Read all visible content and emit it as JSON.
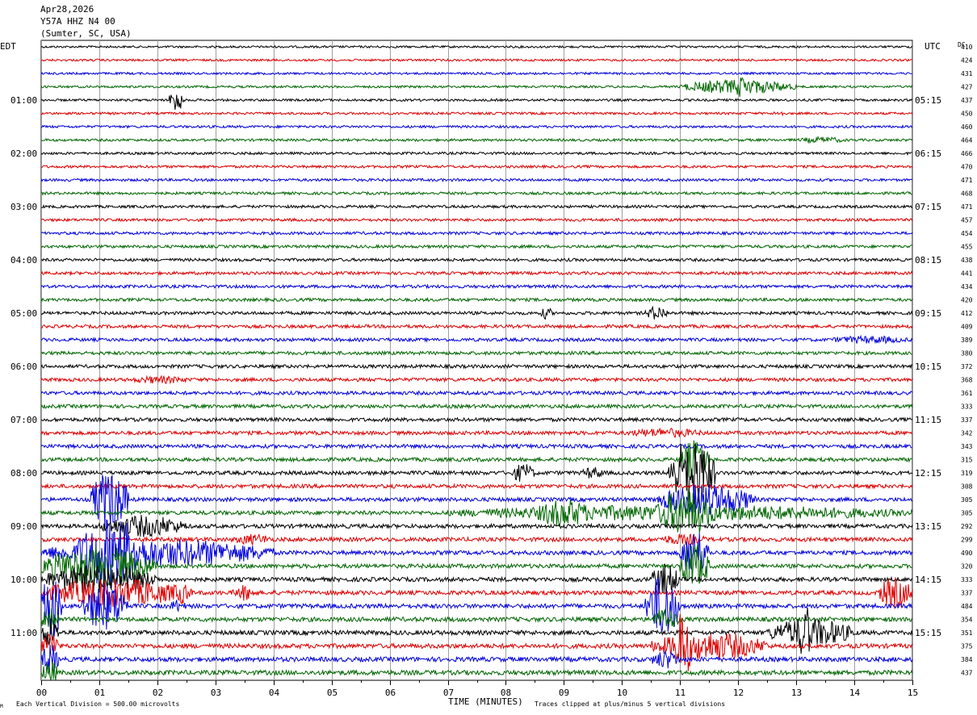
{
  "header": {
    "date": "Apr28,2026",
    "station": "Y57A HHZ N4 00",
    "location": "(Sumter, SC, USA)"
  },
  "chart_data": {
    "type": "line",
    "title": "",
    "left_axis_label": "EDT",
    "right_axis_label": "UTC",
    "dc_label": "DC",
    "xlabel": "TIME (MINUTES)",
    "xlim": [
      0,
      15
    ],
    "x_ticks": [
      "00",
      "01",
      "02",
      "03",
      "04",
      "05",
      "06",
      "07",
      "08",
      "09",
      "10",
      "11",
      "12",
      "13",
      "14",
      "15"
    ],
    "left_hour_labels": [
      "01:00",
      "02:00",
      "03:00",
      "04:00",
      "05:00",
      "06:00",
      "07:00",
      "08:00",
      "09:00",
      "10:00",
      "11:00"
    ],
    "right_hour_labels": [
      "05:15",
      "06:15",
      "07:15",
      "08:15",
      "09:15",
      "10:15",
      "11:15",
      "12:15",
      "13:15",
      "14:15",
      "15:15"
    ],
    "trace_colors": [
      "#000000",
      "#dd0000",
      "#0000dd",
      "#006600"
    ],
    "trace_count": 48,
    "dc_offsets": [
      410,
      424,
      431,
      427,
      437,
      450,
      460,
      464,
      466,
      470,
      471,
      468,
      471,
      457,
      454,
      455,
      438,
      441,
      434,
      420,
      412,
      409,
      389,
      380,
      372,
      368,
      361,
      333,
      337,
      342,
      343,
      315,
      319,
      308,
      305,
      305,
      292,
      299,
      490,
      320,
      333,
      337,
      484,
      354,
      351,
      375,
      384,
      437
    ],
    "scale_note": "Each Vertical Division =   500.00 microvolts",
    "clip_note": "Traces clipped at plus/minus 5 vertical divisions",
    "corner_mark": "M",
    "events": [
      {
        "trace": 4,
        "t0": 2.2,
        "t1": 2.45,
        "amp": 16
      },
      {
        "trace": 3,
        "t0": 11.0,
        "t1": 13.0,
        "amp": 9
      },
      {
        "trace": 3,
        "t0": 11.9,
        "t1": 12.3,
        "amp": 14
      },
      {
        "trace": 5,
        "t0": 12.6,
        "t1": 12.8,
        "amp": 4
      },
      {
        "trace": 7,
        "t0": 13.0,
        "t1": 13.9,
        "amp": 4
      },
      {
        "trace": 20,
        "t0": 8.6,
        "t1": 8.8,
        "amp": 8
      },
      {
        "trace": 20,
        "t0": 10.4,
        "t1": 10.8,
        "amp": 9
      },
      {
        "trace": 22,
        "t0": 13.5,
        "t1": 15.0,
        "amp": 5
      },
      {
        "trace": 25,
        "t0": 1.5,
        "t1": 2.6,
        "amp": 5
      },
      {
        "trace": 29,
        "t0": 10.0,
        "t1": 11.5,
        "amp": 6
      },
      {
        "trace": 32,
        "t0": 8.1,
        "t1": 8.5,
        "amp": 12
      },
      {
        "trace": 32,
        "t0": 9.3,
        "t1": 9.7,
        "amp": 8
      },
      {
        "trace": 32,
        "t0": 10.8,
        "t1": 11.6,
        "amp": 45
      },
      {
        "trace": 31,
        "t0": 11.0,
        "t1": 11.5,
        "amp": 25
      },
      {
        "trace": 34,
        "t0": 0.85,
        "t1": 1.5,
        "amp": 38
      },
      {
        "trace": 34,
        "t0": 10.6,
        "t1": 12.3,
        "amp": 20
      },
      {
        "trace": 35,
        "t0": 7.0,
        "t1": 15.0,
        "amp": 10
      },
      {
        "trace": 35,
        "t0": 8.5,
        "t1": 9.5,
        "amp": 18
      },
      {
        "trace": 35,
        "t0": 10.6,
        "t1": 11.6,
        "amp": 30
      },
      {
        "trace": 36,
        "t0": 1.0,
        "t1": 2.5,
        "amp": 14
      },
      {
        "trace": 37,
        "t0": 3.3,
        "t1": 4.0,
        "amp": 7
      },
      {
        "trace": 37,
        "t0": 10.6,
        "t1": 11.5,
        "amp": 7
      },
      {
        "trace": 38,
        "t0": 0.0,
        "t1": 4.0,
        "amp": 18
      },
      {
        "trace": 38,
        "t0": 0.6,
        "t1": 1.8,
        "amp": 45
      },
      {
        "trace": 38,
        "t0": 11.0,
        "t1": 11.5,
        "amp": 30
      },
      {
        "trace": 39,
        "t0": 0.0,
        "t1": 2.0,
        "amp": 25
      },
      {
        "trace": 39,
        "t0": 11.0,
        "t1": 11.5,
        "amp": 30
      },
      {
        "trace": 40,
        "t0": 0.0,
        "t1": 2.0,
        "amp": 18
      },
      {
        "trace": 40,
        "t0": 10.5,
        "t1": 11.0,
        "amp": 20
      },
      {
        "trace": 41,
        "t0": 0.0,
        "t1": 2.5,
        "amp": 18
      },
      {
        "trace": 41,
        "t0": 2.2,
        "t1": 2.6,
        "amp": 14
      },
      {
        "trace": 41,
        "t0": 3.3,
        "t1": 3.7,
        "amp": 10
      },
      {
        "trace": 41,
        "t0": 14.4,
        "t1": 15.0,
        "amp": 20
      },
      {
        "trace": 42,
        "t0": 0.0,
        "t1": 0.35,
        "amp": 45
      },
      {
        "trace": 42,
        "t0": 0.7,
        "t1": 1.5,
        "amp": 30
      },
      {
        "trace": 42,
        "t0": 2.2,
        "t1": 2.5,
        "amp": 8
      },
      {
        "trace": 42,
        "t0": 10.4,
        "t1": 11.0,
        "amp": 40
      },
      {
        "trace": 43,
        "t0": 0.0,
        "t1": 0.3,
        "amp": 20
      },
      {
        "trace": 43,
        "t0": 10.5,
        "t1": 11.0,
        "amp": 15
      },
      {
        "trace": 44,
        "t0": 0.0,
        "t1": 0.3,
        "amp": 20
      },
      {
        "trace": 44,
        "t0": 12.5,
        "t1": 14.0,
        "amp": 18
      },
      {
        "trace": 44,
        "t0": 13.0,
        "t1": 13.3,
        "amp": 35
      },
      {
        "trace": 45,
        "t0": 0.0,
        "t1": 0.3,
        "amp": 20
      },
      {
        "trace": 45,
        "t0": 10.5,
        "t1": 12.5,
        "amp": 18
      },
      {
        "trace": 45,
        "t0": 10.9,
        "t1": 11.2,
        "amp": 45
      },
      {
        "trace": 46,
        "t0": 0.0,
        "t1": 0.3,
        "amp": 20
      },
      {
        "trace": 46,
        "t0": 10.5,
        "t1": 11.0,
        "amp": 12
      },
      {
        "trace": 47,
        "t0": 0.0,
        "t1": 0.3,
        "amp": 15
      }
    ]
  }
}
